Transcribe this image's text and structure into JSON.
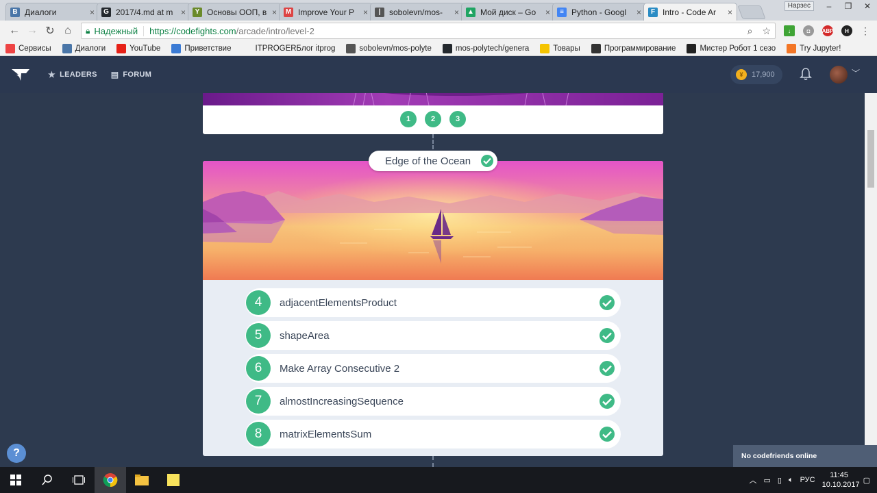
{
  "browser": {
    "tabs": [
      {
        "title": "Диалоги",
        "favicon_color": "#4a76a8",
        "glyph": "В"
      },
      {
        "title": "2017/4.md at m",
        "favicon_color": "#24292e",
        "glyph": "G"
      },
      {
        "title": "Основы ООП, в",
        "favicon_color": "#6a8a2a",
        "glyph": "Y"
      },
      {
        "title": "Improve Your P",
        "favicon_color": "#d44",
        "glyph": "M"
      },
      {
        "title": "sobolevn/mos-",
        "favicon_color": "#555",
        "glyph": "|"
      },
      {
        "title": "Мой диск – Go",
        "favicon_color": "#1fa463",
        "glyph": "▲"
      },
      {
        "title": "Python - Googl",
        "favicon_color": "#4285f4",
        "glyph": "≡"
      },
      {
        "title": "Intro - Code Ar",
        "favicon_color": "#2b8cc4",
        "glyph": "F"
      }
    ],
    "user_label": "Нарзес",
    "address": {
      "secure_label": "Надежный",
      "url_host": "https://codefights.com",
      "url_path": "/arcade/intro/level-2"
    },
    "bookmarks": [
      {
        "label": "Сервисы",
        "color": "#e44"
      },
      {
        "label": "Диалоги",
        "color": "#4a76a8"
      },
      {
        "label": "YouTube",
        "color": "#e62117"
      },
      {
        "label": "Приветствие",
        "color": "#3b7bd4"
      },
      {
        "label": "ITPROGERБлог itprog",
        "color": "#f2f2f2"
      },
      {
        "label": "sobolevn/mos-polyte",
        "color": "#555"
      },
      {
        "label": "mos-polytech/genera",
        "color": "#24292e"
      },
      {
        "label": "Товары",
        "color": "#f5c400"
      },
      {
        "label": "Программирование",
        "color": "#333"
      },
      {
        "label": "Мистер Робот 1 сезо",
        "color": "#222"
      },
      {
        "label": "Try Jupyter!",
        "color": "#f37626"
      }
    ]
  },
  "site": {
    "nav": [
      {
        "label": "LEADERS",
        "icon": "star-icon"
      },
      {
        "label": "FORUM",
        "icon": "chat-icon"
      }
    ],
    "coins": "17,900",
    "levels_prev": [
      "1",
      "2",
      "3"
    ],
    "section_title": "Edge of the Ocean",
    "tasks": [
      {
        "num": "4",
        "name": "adjacentElementsProduct"
      },
      {
        "num": "5",
        "name": "shapeArea"
      },
      {
        "num": "6",
        "name": "Make Array Consecutive 2"
      },
      {
        "num": "7",
        "name": "almostIncreasingSequence"
      },
      {
        "num": "8",
        "name": "matrixElementsSum"
      }
    ],
    "help": "?",
    "friends_status": "No codefriends online"
  },
  "taskbar": {
    "lang": "РУС",
    "time": "11:45",
    "date": "10.10.2017"
  },
  "colors": {
    "accent_green": "#3fba86",
    "header_bg": "#2b3850",
    "page_bg": "#2d3a4f"
  }
}
